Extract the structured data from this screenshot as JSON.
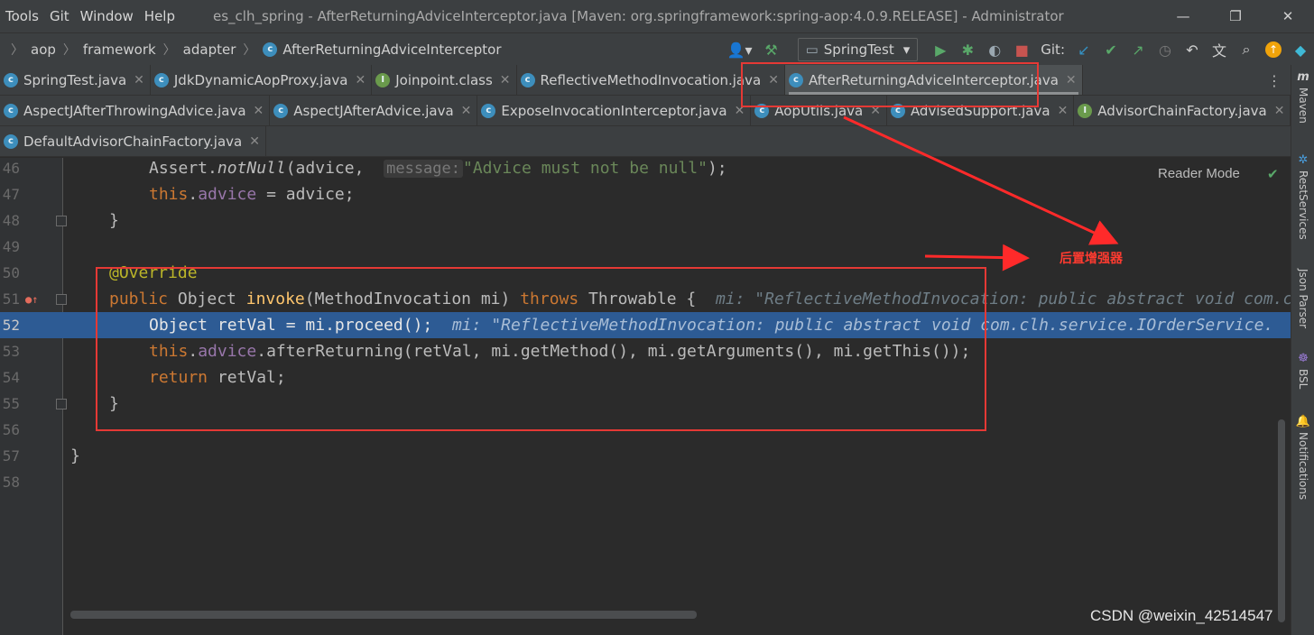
{
  "menu": [
    "Tools",
    "Git",
    "Window",
    "Help"
  ],
  "window_title": "es_clh_spring - AfterReturningAdviceInterceptor.java [Maven: org.springframework:spring-aop:4.0.9.RELEASE] - Administrator",
  "breadcrumbs": [
    "aop",
    "framework",
    "adapter",
    "AfterReturningAdviceInterceptor"
  ],
  "run_config": "SpringTest",
  "git_label": "Git:",
  "tabs_row1": [
    {
      "label": "SpringTest.java",
      "icon": "c"
    },
    {
      "label": "JdkDynamicAopProxy.java",
      "icon": "c"
    },
    {
      "label": "Joinpoint.class",
      "icon": "i"
    },
    {
      "label": "ReflectiveMethodInvocation.java",
      "icon": "c"
    },
    {
      "label": "AfterReturningAdviceInterceptor.java",
      "icon": "c",
      "active": true
    }
  ],
  "tabs_row2": [
    {
      "label": "AspectJAfterThrowingAdvice.java",
      "icon": "c"
    },
    {
      "label": "AspectJAfterAdvice.java",
      "icon": "c"
    },
    {
      "label": "ExposeInvocationInterceptor.java",
      "icon": "c"
    },
    {
      "label": "AopUtils.java",
      "icon": "c"
    },
    {
      "label": "AdvisedSupport.java",
      "icon": "c"
    },
    {
      "label": "AdvisorChainFactory.java",
      "icon": "i"
    }
  ],
  "tabs_row3": [
    {
      "label": "DefaultAdvisorChainFactory.java",
      "icon": "c"
    }
  ],
  "right_tools": [
    "Maven",
    "RestServices",
    "Json Parser",
    "BSL",
    "Notifications"
  ],
  "reader_mode": "Reader Mode",
  "line_numbers": [
    "46",
    "47",
    "48",
    "49",
    "50",
    "51",
    "52",
    "53",
    "54",
    "55",
    "56",
    "57",
    "58"
  ],
  "code": {
    "l46_a": "Assert.",
    "l46_b": "notNull",
    "l46_c": "(advice, ",
    "l46_hint": "message:",
    "l46_str": "\"Advice must not be null\"",
    "l46_d": ");",
    "l47_this": "this",
    "l47_dot": ".",
    "l47_field": "advice",
    "l47_rest": " = advice;",
    "l48": "}",
    "l50": "@Override",
    "l51_kw": "public",
    "l51_a": " Object ",
    "l51_fn": "invoke",
    "l51_b": "(MethodInvocation mi) ",
    "l51_kw2": "throws",
    "l51_c": " Throwable {",
    "l51_inlay": "mi: \"ReflectiveMethodInvocation: public abstract void com.clh.service.IOrderService.",
    "l52_a": "Object retVal = mi.proceed();",
    "l52_inlay": "mi: \"ReflectiveMethodInvocation: public abstract void com.clh.service.IOrderService.",
    "l53_this": "this",
    "l53_dot": ".",
    "l53_field": "advice",
    "l53_rest": ".afterReturning(retVal, mi.getMethod(), mi.getArguments(), mi.getThis());",
    "l54_kw": "return",
    "l54_rest": " retVal;",
    "l55": "}",
    "l57": "}"
  },
  "annotation_label": "后置增强器",
  "watermark": "CSDN @weixin_42514547",
  "colors": {
    "highlight_line": "#2d5b94",
    "annotation_red": "#e53935"
  }
}
